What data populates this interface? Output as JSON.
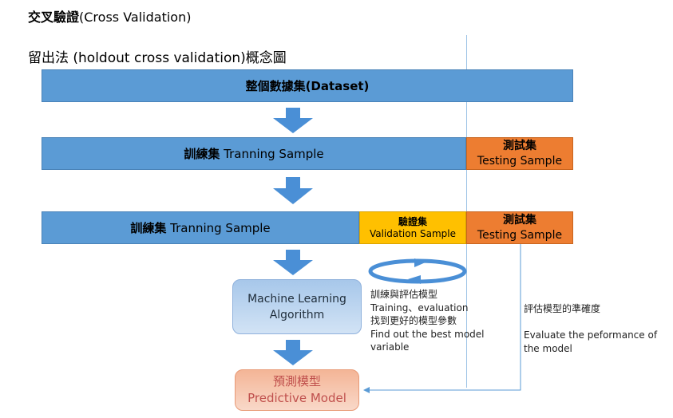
{
  "header": {
    "title_bold": "交叉驗證",
    "title_rest": "(Cross Validation)",
    "subtitle": "留出法 (holdout cross validation)概念圖"
  },
  "bars": {
    "dataset": "整個數據集(Dataset)",
    "train_zh": "訓練集",
    "train_en": "Tranning Sample",
    "test_zh": "測試集",
    "test_en": "Testing Sample",
    "valid_zh": "驗證集",
    "valid_en": "Validation Sample"
  },
  "ml_box": {
    "line1": "Machine Learning",
    "line2": "Algorithm"
  },
  "predict_box": {
    "line1": "預測模型",
    "line2": "Predictive Model"
  },
  "notes_left": [
    "訓練與評估模型",
    "Training、evaluation",
    "找到更好的模型參數",
    "Find out the best model",
    "variable"
  ],
  "notes_right": [
    "評估模型的準確度",
    "",
    "Evaluate the peformance of",
    "the model"
  ],
  "colors": {
    "train_blue": "#5b9bd5",
    "validation_yellow": "#ffc000",
    "test_orange": "#ed7d31",
    "arrow_blue": "#4a8fd6"
  }
}
